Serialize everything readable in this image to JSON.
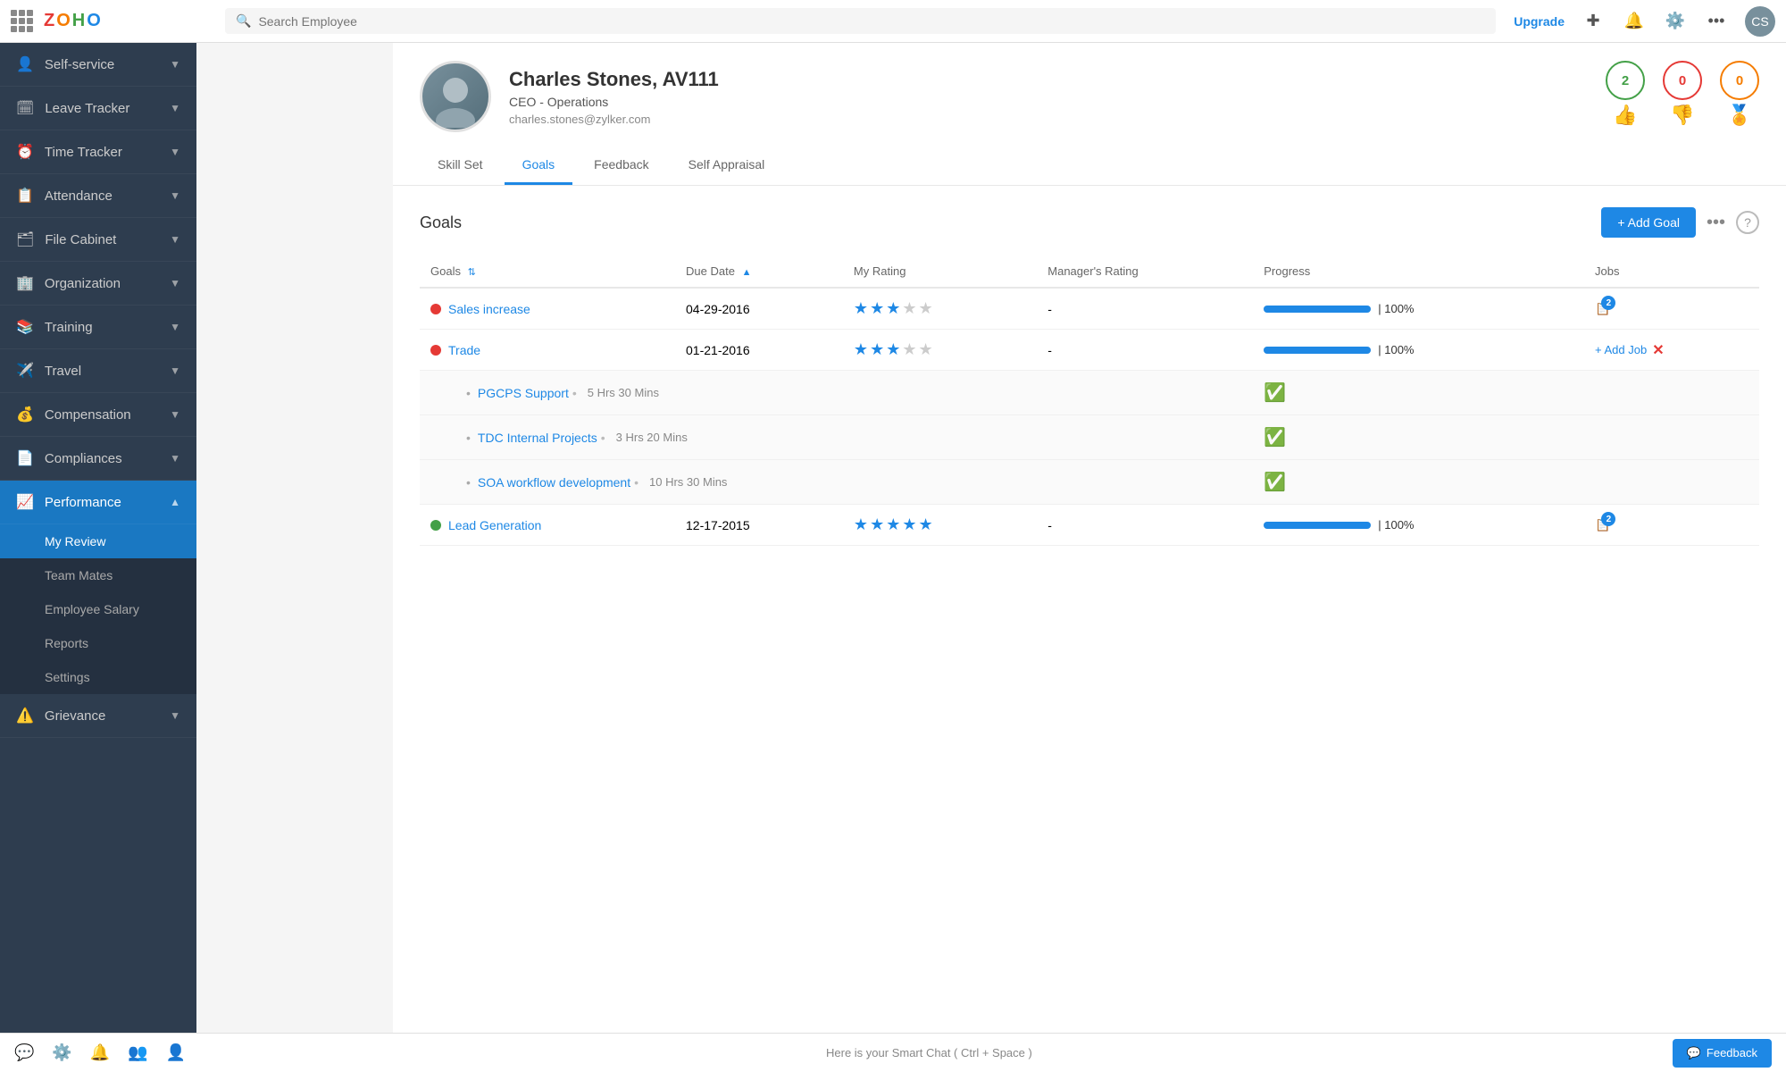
{
  "topbar": {
    "search_placeholder": "Search Employee",
    "upgrade_label": "Upgrade"
  },
  "sidebar": {
    "items": [
      {
        "id": "self-service",
        "label": "Self-service",
        "icon": "👤",
        "expandable": true,
        "active": false
      },
      {
        "id": "leave-tracker",
        "label": "Leave Tracker",
        "icon": "🗓",
        "expandable": true,
        "active": false
      },
      {
        "id": "time-tracker",
        "label": "Time Tracker",
        "icon": "⏰",
        "expandable": true,
        "active": false
      },
      {
        "id": "attendance",
        "label": "Attendance",
        "icon": "📋",
        "expandable": true,
        "active": false
      },
      {
        "id": "file-cabinet",
        "label": "File Cabinet",
        "icon": "🗂",
        "expandable": true,
        "active": false
      },
      {
        "id": "organization",
        "label": "Organization",
        "icon": "🏢",
        "expandable": true,
        "active": false
      },
      {
        "id": "training",
        "label": "Training",
        "icon": "📚",
        "expandable": true,
        "active": false
      },
      {
        "id": "travel",
        "label": "Travel",
        "icon": "✈️",
        "expandable": true,
        "active": false
      },
      {
        "id": "compensation",
        "label": "Compensation",
        "icon": "💰",
        "expandable": true,
        "active": false
      },
      {
        "id": "compliances",
        "label": "Compliances",
        "icon": "📄",
        "expandable": true,
        "active": false
      },
      {
        "id": "performance",
        "label": "Performance",
        "icon": "📈",
        "expandable": true,
        "active": true
      },
      {
        "id": "grievance",
        "label": "Grievance",
        "icon": "⚠️",
        "expandable": true,
        "active": false
      }
    ],
    "sub_items": [
      {
        "id": "my-review",
        "label": "My Review",
        "active": true
      },
      {
        "id": "team-mates",
        "label": "Team Mates",
        "active": false
      },
      {
        "id": "employee-salary",
        "label": "Employee Salary",
        "active": false
      },
      {
        "id": "reports",
        "label": "Reports",
        "active": false
      },
      {
        "id": "settings",
        "label": "Settings",
        "active": false
      }
    ]
  },
  "employee": {
    "name": "Charles Stones, AV111",
    "title": "CEO - Operations",
    "email": "charles.stones@zylker.com",
    "badge_positive": "2",
    "badge_negative": "0",
    "badge_award": "0"
  },
  "tabs": [
    {
      "id": "skill-set",
      "label": "Skill Set",
      "active": false
    },
    {
      "id": "goals",
      "label": "Goals",
      "active": true
    },
    {
      "id": "feedback",
      "label": "Feedback",
      "active": false
    },
    {
      "id": "self-appraisal",
      "label": "Self Appraisal",
      "active": false
    }
  ],
  "goals_section": {
    "title": "Goals",
    "add_button": "+ Add Goal"
  },
  "table": {
    "columns": [
      {
        "id": "goals",
        "label": "Goals",
        "sortable": true
      },
      {
        "id": "due-date",
        "label": "Due Date",
        "sortable": true
      },
      {
        "id": "my-rating",
        "label": "My Rating",
        "sortable": false
      },
      {
        "id": "managers-rating",
        "label": "Manager's Rating",
        "sortable": false
      },
      {
        "id": "progress",
        "label": "Progress",
        "sortable": false
      },
      {
        "id": "jobs",
        "label": "Jobs",
        "sortable": false
      }
    ],
    "rows": [
      {
        "id": "sales-increase",
        "name": "Sales increase",
        "status": "red",
        "due_date": "04-29-2016",
        "my_rating": 3,
        "managers_rating": "-",
        "progress": 100,
        "jobs_count": 2,
        "type": "goal"
      },
      {
        "id": "trade",
        "name": "Trade",
        "status": "red",
        "due_date": "01-21-2016",
        "my_rating": 3,
        "managers_rating": "-",
        "progress": 100,
        "jobs_count": 0,
        "show_add_job": true,
        "type": "goal"
      },
      {
        "id": "pgcps-support",
        "name": "PGCPS Support",
        "time": "5 Hrs 30 Mins",
        "completed": true,
        "type": "sub"
      },
      {
        "id": "tdc-internal",
        "name": "TDC Internal Projects",
        "time": "3 Hrs 20 Mins",
        "completed": true,
        "type": "sub"
      },
      {
        "id": "soa-workflow",
        "name": "SOA workflow development",
        "time": "10 Hrs 30 Mins",
        "completed": true,
        "type": "sub"
      },
      {
        "id": "lead-generation",
        "name": "Lead Generation",
        "status": "green",
        "due_date": "12-17-2015",
        "my_rating": 5,
        "managers_rating": "-",
        "progress": 100,
        "jobs_count": 2,
        "type": "goal"
      }
    ]
  },
  "bottom": {
    "smart_chat": "Here is your Smart Chat ( Ctrl + Space )",
    "feedback_label": "Feedback"
  }
}
